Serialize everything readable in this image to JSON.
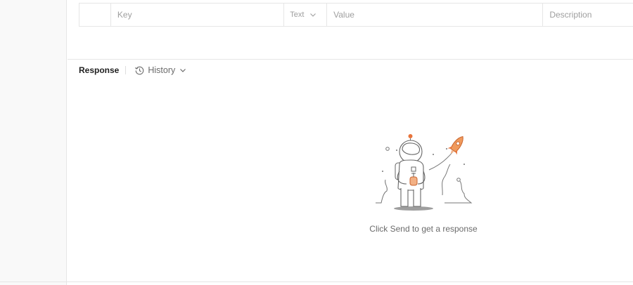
{
  "params_table": {
    "columns": {
      "key_placeholder": "Key",
      "type_label": "Text",
      "value_placeholder": "Value",
      "description_placeholder": "Description"
    }
  },
  "response": {
    "title": "Response",
    "history_label": "History",
    "empty_message": "Click Send to get a response"
  },
  "colors": {
    "accent_orange": "#e8743b",
    "border": "#e6e6e6",
    "muted_text": "#6b6b6b"
  },
  "icons": {
    "history": "history-clock-icon",
    "chevron": "chevron-down-icon",
    "illustration": "astronaut-rocket-illustration"
  }
}
